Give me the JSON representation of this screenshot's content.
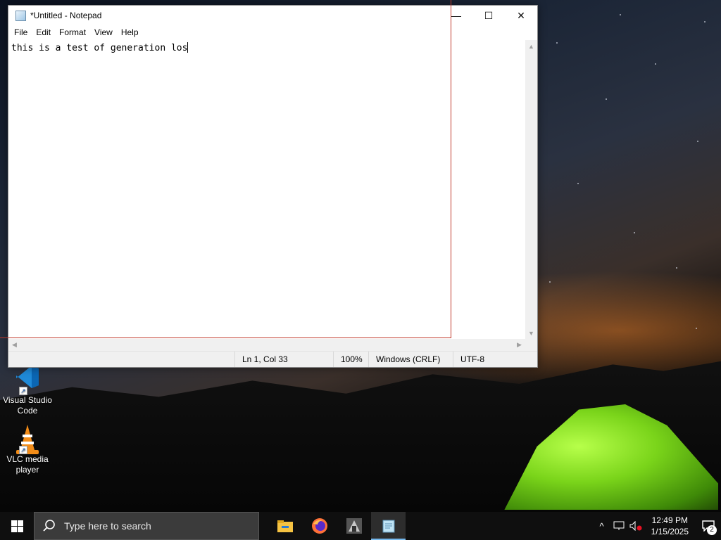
{
  "desktop": {
    "icons": [
      {
        "label": "Visual Studio Code",
        "icon": "vscode-icon"
      },
      {
        "label": "VLC media player",
        "icon": "vlc-icon"
      }
    ]
  },
  "notepad": {
    "title": "*Untitled - Notepad",
    "menu": [
      "File",
      "Edit",
      "Format",
      "View",
      "Help"
    ],
    "content": "this is a test of generation los",
    "status": {
      "position": "Ln 1, Col 33",
      "zoom": "100%",
      "line_ending": "Windows (CRLF)",
      "encoding": "UTF-8"
    },
    "controls": {
      "minimize": "—",
      "maximize": "☐",
      "close": "✕"
    }
  },
  "taskbar": {
    "search_placeholder": "Type here to search",
    "apps": [
      "file-explorer-icon",
      "firefox-icon",
      "app-icon",
      "notepad-icon"
    ],
    "clock": {
      "time": "12:49 PM",
      "date": "1/15/2025"
    },
    "notification_count": "2"
  },
  "colors": {
    "taskbar_bg": "#0f0f0f",
    "accent": "#76b9ed",
    "drag_rect": "#c0392b"
  }
}
